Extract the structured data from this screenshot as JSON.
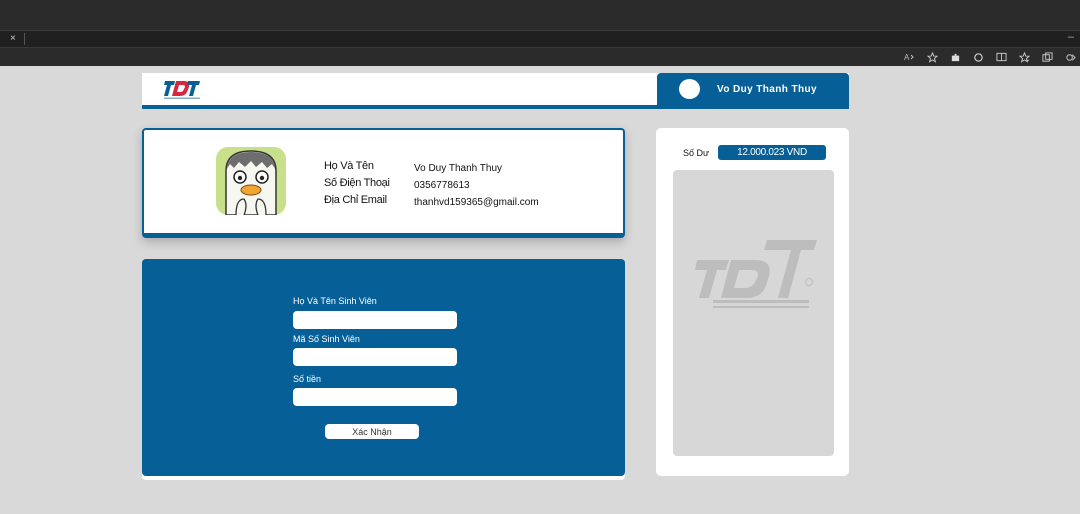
{
  "browser": {
    "close_glyph": "×",
    "minimize_glyph": "–",
    "toolbar_icons": [
      "read-aloud-icon",
      "favorite-star-icon",
      "extensions-icon",
      "refresh-icon",
      "split-screen-icon",
      "favorites-icon",
      "collections-icon",
      "more-icon"
    ]
  },
  "header": {
    "user_name": "Vo Duy Thanh Thuy"
  },
  "profile": {
    "labels": {
      "name": "Họ Và Tên",
      "phone": "Số Điện Thoại",
      "email": "Địa Chỉ Email"
    },
    "values": {
      "name": "Vo Duy Thanh Thuy",
      "phone": "0356778613",
      "email": "thanhvd159365@gmail.com"
    }
  },
  "form": {
    "student_name_label": "Họ Và Tên Sinh Viên",
    "student_name_value": "",
    "student_id_label": "Mã Số Sinh Viên",
    "student_id_value": "",
    "amount_label": "Số tiền",
    "amount_value": "",
    "submit_label": "Xác Nhận"
  },
  "balance": {
    "label": "Số Dư",
    "value": "12.000.023 VND"
  },
  "colors": {
    "brand_blue": "#075f98",
    "page_bg": "#d9d9d9"
  }
}
